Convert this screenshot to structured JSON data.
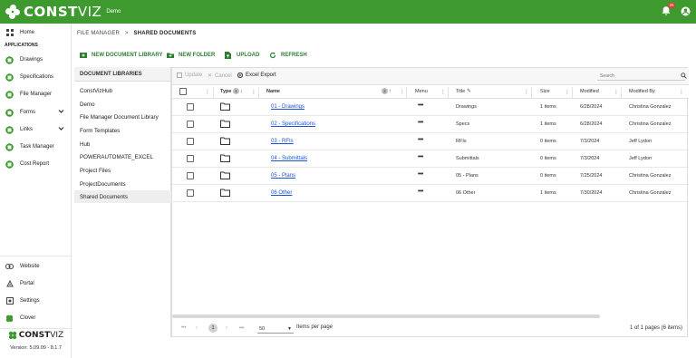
{
  "app": {
    "logo_bold": "CONST",
    "logo_thin": "VIZ",
    "env_label": "Demo",
    "notification_count": "25",
    "accent": "#3e9a2e"
  },
  "sidebar": {
    "top_items": [
      {
        "label": "Home",
        "icon": "grid-icon"
      }
    ],
    "section_label": "APPLICATIONS",
    "items": [
      {
        "label": "Drawings",
        "icon": "app-icon"
      },
      {
        "label": "Specifications",
        "icon": "app-icon"
      },
      {
        "label": "File Manager",
        "icon": "app-icon"
      },
      {
        "label": "Forms",
        "icon": "app-icon",
        "expandable": true
      },
      {
        "label": "Links",
        "icon": "app-icon",
        "expandable": true
      },
      {
        "label": "Task Manager",
        "icon": "app-icon"
      },
      {
        "label": "Cost Report",
        "icon": "app-icon"
      }
    ],
    "bottom_items": [
      {
        "label": "Website",
        "icon": "link-icon"
      },
      {
        "label": "Portal",
        "icon": "portal-icon"
      },
      {
        "label": "Settings",
        "icon": "settings-icon"
      },
      {
        "label": "Clover",
        "icon": "clover-icon"
      }
    ],
    "footer_logo_bold": "CONST",
    "footer_logo_thin": "VIZ",
    "version": "Version: 5.09.09 - 8.1.7"
  },
  "breadcrumb": {
    "parent": "FILE MANAGER",
    "separator": ">",
    "current": "SHARED DOCUMENTS"
  },
  "toolbar": {
    "new_library": "NEW DOCUMENT LIBRARY",
    "new_folder": "NEW FOLDER",
    "upload": "UPLOAD",
    "refresh": "REFRESH"
  },
  "libraries": {
    "header": "DOCUMENT LIBRARIES",
    "items": [
      "ConstVizHub",
      "Demo",
      "File Manager Document Library",
      "Form Templates",
      "Hub",
      "POWERAUTOMATE_EXCEL",
      "Project Files",
      "ProjectDocuments",
      "Shared Documents"
    ],
    "active_index": 8
  },
  "grid": {
    "update_label": "Update",
    "cancel_label": "Cancel",
    "export_label": "Excel Export",
    "search_placeholder": "Search",
    "columns": {
      "type": "Type",
      "type_sort_index": "1",
      "name": "Name",
      "name_sort_index": "2",
      "menu": "Menu",
      "title": "Title",
      "size": "Size",
      "modified": "Modified",
      "modified_by": "Modified By"
    },
    "rows": [
      {
        "name": "01 - Drawings",
        "title": "Drawings",
        "size": "1 items",
        "modified": "6/28/2024",
        "modified_by": "Christina Gonzalez"
      },
      {
        "name": "02 - Specifications",
        "title": "Specs",
        "size": "1 items",
        "modified": "6/28/2024",
        "modified_by": "Christina Gonzalez"
      },
      {
        "name": "03 - RFIs",
        "title": "RFIs",
        "size": "0 items",
        "modified": "7/3/2024",
        "modified_by": "Jeff Lydon"
      },
      {
        "name": "04 - Submittals",
        "title": "Submittals",
        "size": "0 items",
        "modified": "7/3/2024",
        "modified_by": "Jeff Lydon"
      },
      {
        "name": "05 - Plans",
        "title": "05 - Plans",
        "size": "0 items",
        "modified": "7/25/2024",
        "modified_by": "Christina Gonzalez"
      },
      {
        "name": "06 Other",
        "title": "06 Other",
        "size": "1 items",
        "modified": "7/30/2024",
        "modified_by": "Christina Gonzalez"
      }
    ],
    "pager": {
      "current_page": "1",
      "page_size": "50",
      "page_size_label": "Items per page",
      "summary": "1 of 1 pages (6 items)"
    }
  }
}
